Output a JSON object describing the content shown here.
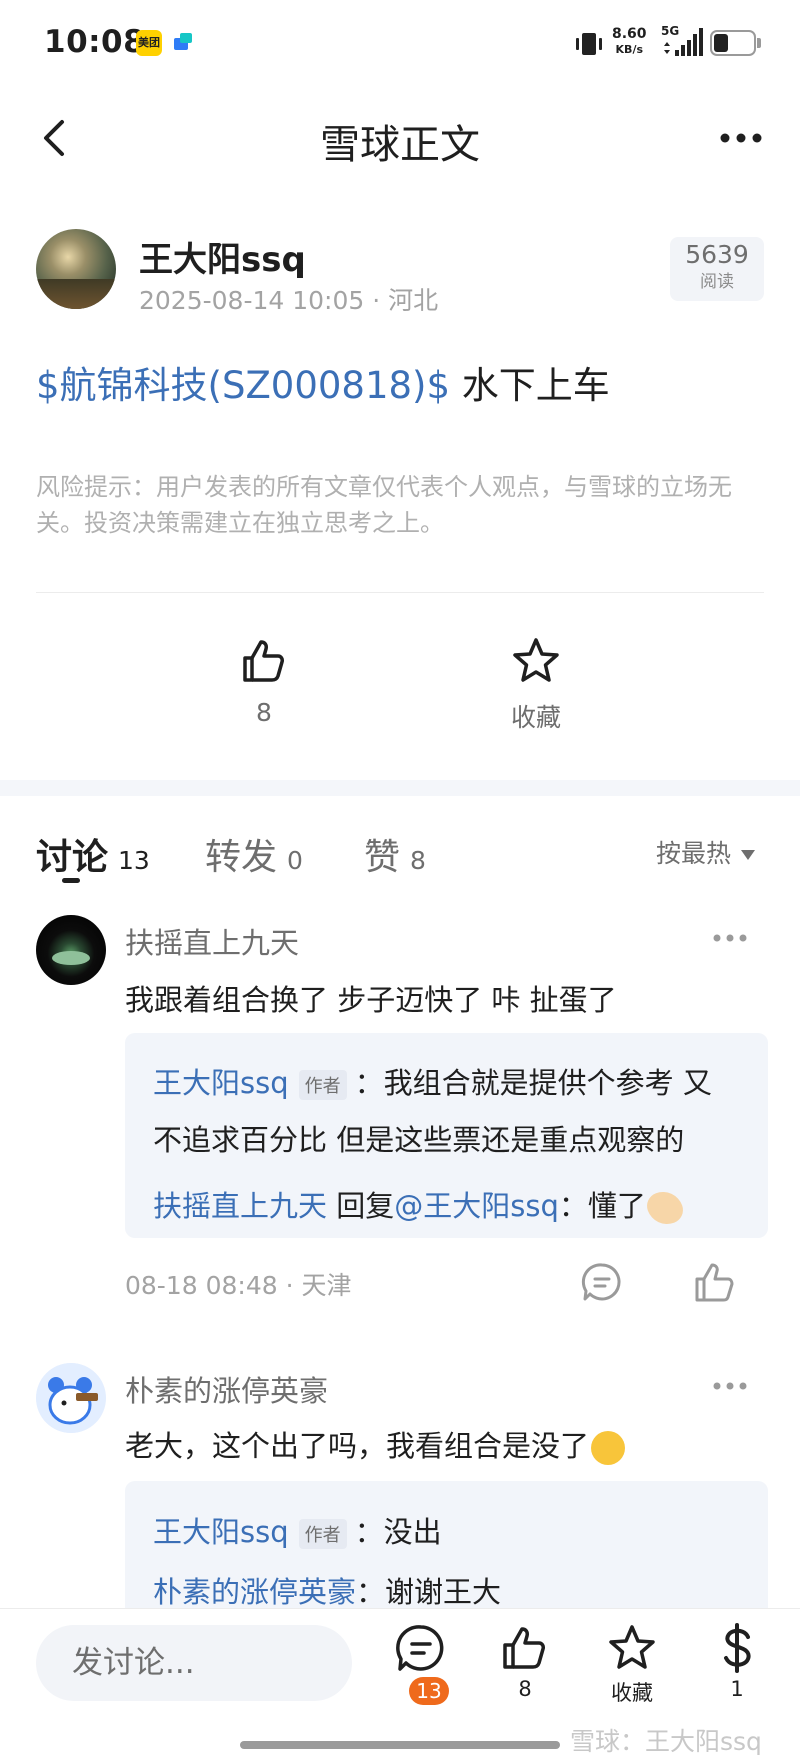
{
  "status_bar": {
    "time": "10:08",
    "app_badge_meituan": "美团",
    "net_speed_value": "8.60",
    "net_speed_unit": "KB/s",
    "network_type": "5G",
    "battery_level": 0.35
  },
  "header": {
    "title": "雪球正文"
  },
  "post": {
    "author": "王大阳ssq",
    "meta": "2025-08-14 10:05 · 河北",
    "read_count": "5639",
    "read_label": "阅读",
    "stock_tag": "$航锦科技(SZ000818)$",
    "text": " 水下上车",
    "risk_note": "风险提示：用户发表的所有文章仅代表个人观点，与雪球的立场无关。投资决策需建立在独立思考之上。",
    "like_count": "8",
    "favorite_label": "收藏"
  },
  "tabs": [
    {
      "label": "讨论",
      "count": "13"
    },
    {
      "label": "转发",
      "count": "0"
    },
    {
      "label": "赞",
      "count": "8"
    }
  ],
  "sort_label": "按最热",
  "comments": [
    {
      "user": "扶摇直上九天",
      "text": "我跟着组合换了 步子迈快了 咔 扯蛋了",
      "reply_author": "王大阳ssq",
      "author_tag": "作者",
      "reply_line1": "：我组合就是提供个参考 又",
      "reply_line2": "不追求百分比 但是这些票还是重点观察的",
      "sub_user": "扶摇直上九天",
      "sub_reply_word": " 回复",
      "sub_mention": "@王大阳ssq",
      "sub_text": "：懂了",
      "meta": "08-18 08:48 · 天津"
    },
    {
      "user": "朴素的涨停英豪",
      "text": "老大，这个出了吗，我看组合是没了",
      "reply_author": "王大阳ssq",
      "author_tag": "作者",
      "reply_text": "：没出",
      "sub_user": "朴素的涨停英豪",
      "sub_text": "：谢谢王大"
    }
  ],
  "bottom_bar": {
    "input_placeholder": "发讨论...",
    "comment_count": "13",
    "like_count": "8",
    "favorite_label": "收藏",
    "reward_count": "1"
  },
  "watermark": "雪球：王大阳ssq"
}
